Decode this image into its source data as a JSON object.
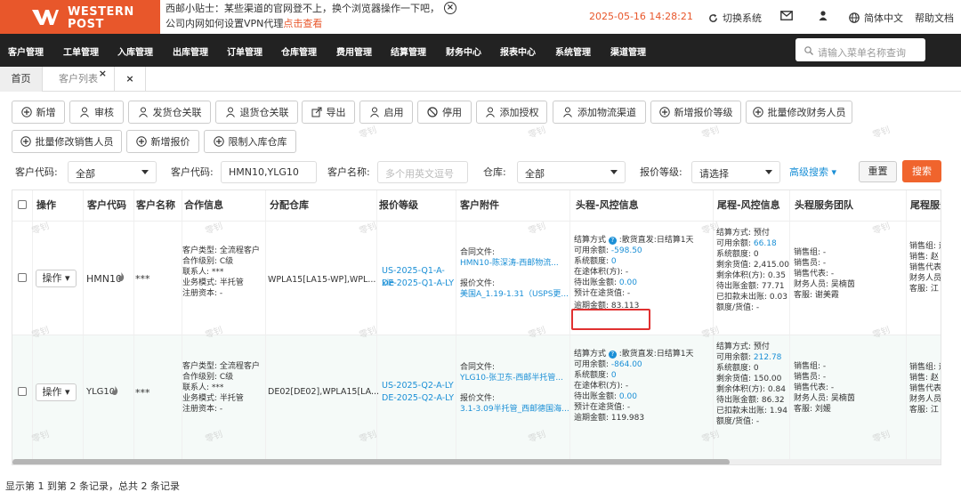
{
  "brand": {
    "line1": "WESTERN",
    "line2": "POST"
  },
  "notice": {
    "text": "西邮小贴士：某些渠道的官网登不上，换个浏览器操作一下吧，公司内网如何设置VPN代理",
    "link": "点击查看"
  },
  "datetime": "2025-05-16 14:28:21",
  "top_actions": {
    "switch": "切换系统",
    "lang": "简体中文",
    "help": "帮助文档"
  },
  "menu": [
    "客户管理",
    "工单管理",
    "入库管理",
    "出库管理",
    "订单管理",
    "仓库管理",
    "费用管理",
    "结算管理",
    "财务中心",
    "报表中心",
    "系统管理",
    "渠道管理"
  ],
  "search": {
    "placeholder": "请输入菜单名称查询"
  },
  "tabs": {
    "home": "首页",
    "current": "客户列表",
    "close": "×"
  },
  "toolbar": [
    "新增",
    "审核",
    "发货仓关联",
    "退货仓关联",
    "导出",
    "启用",
    "停用",
    "添加授权",
    "添加物流渠道",
    "新增报价等级",
    "批量修改财务人员",
    "批量修改销售人员",
    "新增报价",
    "限制入库仓库"
  ],
  "filters": {
    "code_label": "客户代码:",
    "code_value": "全部",
    "code2_label": "客户代码:",
    "code2_value": "HMN10,YLG10",
    "name_label": "客户名称:",
    "name_placeholder": "多个用英文逗号",
    "wh_label": "仓库:",
    "wh_value": "全部",
    "level_label": "报价等级:",
    "level_value": "请选择",
    "advanced": "高级搜索",
    "reset": "重置",
    "search": "搜索"
  },
  "columns": [
    "操作",
    "客户代码",
    "客户名称",
    "合作信息",
    "分配仓库",
    "报价等级",
    "客户附件",
    "头程-风控信息",
    "尾程-风控信息",
    "头程服务团队",
    "尾程服务"
  ],
  "rows": [
    {
      "op": "操作",
      "code": "HMN10",
      "name": "***",
      "coop": [
        "客户类型: 全流程客户",
        "合作级别: C级",
        "联系人: ***",
        "业务模式: 半托管",
        "注册资本: -"
      ],
      "warehouse": "WPLA15[LA15-WP],WPL...",
      "levels": [
        "US-2025-Q1-A-xie",
        "DE-2025-Q1-A-LY"
      ],
      "attach": {
        "contract_label": "合同文件:",
        "contract": "HMN10-陈深涛-西邮物流...",
        "quote_label": "报价文件:",
        "quote": "美国A_1.19-1.31（USPS更..."
      },
      "head": {
        "settle": "结算方式",
        "settle_val": ":散货直发:日结算1天",
        "avail_label": "可用余额:",
        "avail": "-598.50",
        "sys_label": "系统额度:",
        "sys": "0",
        "vol": "在途体积(方): -",
        "pend_label": "待出账金额:",
        "pend": "0.00",
        "goods": "预计在途货值: -",
        "overdue": "逾期金额: 83.113"
      },
      "tail": {
        "settle": "结算方式: 预付",
        "avail_label": "可用余额:",
        "avail": "66.18",
        "sys": "系统额度: 0",
        "remain": "剩余货值: 2,415.00",
        "vol": "剩余体积(方): 0.35",
        "pend": "待出账金额: 77.71",
        "out": "已扣款未出账: 0.03",
        "ratio": "额度/货值: -"
      },
      "team": [
        "销售组: -",
        "销售员: -",
        "销售代表: -",
        "财务人员: 吴楠茵",
        "客服: 谢美霞"
      ],
      "tail_team": [
        "销售组: 运",
        "销售: 赵",
        "销售代表: 运",
        "财务人员",
        "客服: 江"
      ]
    },
    {
      "op": "操作",
      "code": "YLG10",
      "name": "***",
      "coop": [
        "客户类型: 全流程客户",
        "合作级别: C级",
        "联系人: ***",
        "业务模式: 半托管",
        "注册资本: -"
      ],
      "warehouse": "DE02[DE02],WPLA15[LA...",
      "levels": [
        "US-2025-Q2-A-LY",
        "DE-2025-Q2-A-LY"
      ],
      "attach": {
        "contract_label": "合同文件:",
        "contract": "YLG10-张卫东-西邮半托管...",
        "quote_label": "报价文件:",
        "quote": "3.1-3.09半托管_西邮德国海..."
      },
      "head": {
        "settle": "结算方式",
        "settle_val": ":散货直发:日结算1天",
        "avail_label": "可用余额:",
        "avail": "-864.00",
        "sys_label": "系统额度:",
        "sys": "0",
        "vol": "在途体积(方): -",
        "pend_label": "待出账金额:",
        "pend": "0.00",
        "goods": "预计在途货值: -",
        "overdue": "逾期金额: 119.983"
      },
      "tail": {
        "settle": "结算方式: 预付",
        "avail_label": "可用余额:",
        "avail": "212.78",
        "sys": "系统额度: 0",
        "remain": "剩余货值: 150.00",
        "vol": "剩余体积(方): 0.84",
        "pend": "待出账金额: 86.32",
        "out": "已扣款未出账: 1.94",
        "ratio": "额度/货值: -"
      },
      "team": [
        "销售组: -",
        "销售员: -",
        "销售代表: -",
        "财务人员: 吴楠茵",
        "客服: 刘媛"
      ],
      "tail_team": [
        "销售组: 运",
        "销售: 赵",
        "销售代表: 运",
        "财务人员",
        "客服: 江"
      ]
    }
  ],
  "footer": "显示第 1 到第 2 条记录，总共 2 条记录",
  "watermark": "零钊",
  "colors": {
    "brand": "#e8572b",
    "nav": "#222222",
    "link": "#1a8fd6",
    "highlight_box": "#e03030"
  }
}
